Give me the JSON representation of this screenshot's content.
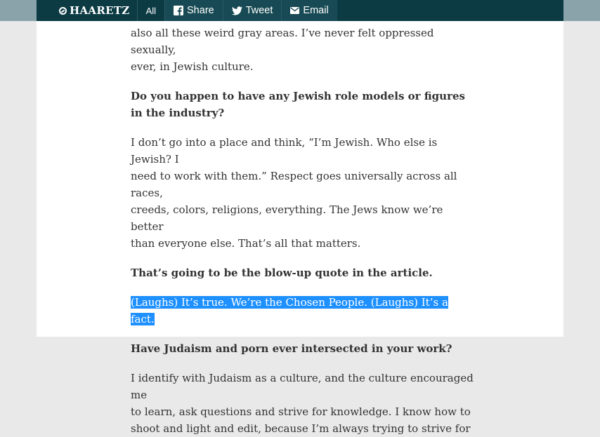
{
  "topbar": {
    "logo_text": "HAARETZ",
    "all_label": "All",
    "share_label": "Share",
    "tweet_label": "Tweet",
    "email_label": "Email",
    "icons": [
      "haaretz-logo-icon",
      "facebook-icon",
      "twitter-icon",
      "email-icon"
    ]
  },
  "article": {
    "p0_line1": "also all these weird gray areas. I’ve never felt oppressed sexually,",
    "p0_line2": "ever, in Jewish culture.",
    "q1_line1": "Do you happen to have any Jewish role models or figures",
    "q1_line2": "in the industry?",
    "a1_line1": "I don’t go into a place and think, “I’m Jewish. Who else is Jewish? I",
    "a1_line2": "need to work with them.” Respect goes universally across all races,",
    "a1_line3": "creeds, colors, religions, everything. The Jews know we’re better",
    "a1_line4": "than everyone else. That’s all that matters.",
    "q2": "That’s going to be the blow-up quote in the article.",
    "a2_highlighted": "(Laughs) It’s true. We’re the Chosen People. (Laughs) It’s a fact.",
    "q3": "Have Judaism and porn ever intersected in your work?",
    "a3_line1": "I identify with Judaism as a culture, and the culture encouraged me",
    "a3_line2": "to learn, ask questions and strive for knowledge. I know how to",
    "a3_line3": "shoot and light and edit, because I’m always trying to strive for"
  },
  "colors": {
    "topbar": "#0c3b44",
    "topbar_side": "#8aa3aa",
    "selection_highlight": "#1e90ff",
    "text": "#333333"
  }
}
